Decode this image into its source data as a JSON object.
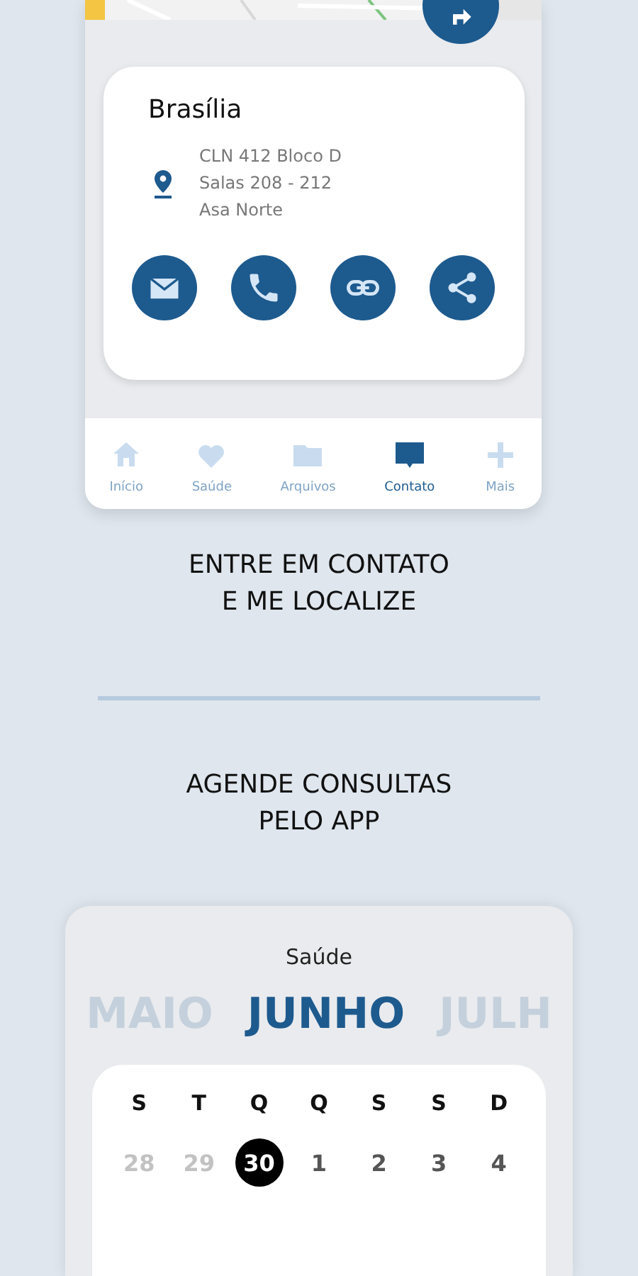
{
  "location": {
    "city": "Brasília",
    "address": [
      "CLN 412 Bloco D",
      "Salas 208 - 212",
      "Asa Norte"
    ]
  },
  "contact_actions": [
    {
      "kind": "email"
    },
    {
      "kind": "phone"
    },
    {
      "kind": "link"
    },
    {
      "kind": "share"
    }
  ],
  "nav": [
    {
      "kind": "home",
      "label": "Início",
      "selected": false
    },
    {
      "kind": "heart",
      "label": "Saúde",
      "selected": false
    },
    {
      "kind": "folder",
      "label": "Arquivos",
      "selected": false
    },
    {
      "kind": "chat",
      "label": "Contato",
      "selected": true
    },
    {
      "kind": "plus",
      "label": "Mais",
      "selected": false
    }
  ],
  "caption_1": [
    "ENTRE EM CONTATO",
    "E ME LOCALIZE"
  ],
  "caption_2": [
    "AGENDE CONSULTAS",
    "PELO APP"
  ],
  "calendar": {
    "title": "Saúde",
    "months": [
      {
        "label": "MAIO",
        "selected": false
      },
      {
        "label": "JUNHO",
        "selected": true
      },
      {
        "label": "JULH",
        "selected": false
      }
    ],
    "weekdays": [
      "S",
      "T",
      "Q",
      "Q",
      "S",
      "S",
      "D"
    ],
    "days": [
      {
        "label": "28",
        "muted": true,
        "selected": false
      },
      {
        "label": "29",
        "muted": true,
        "selected": false
      },
      {
        "label": "30",
        "muted": false,
        "selected": true
      },
      {
        "label": "1",
        "muted": false,
        "selected": false
      },
      {
        "label": "2",
        "muted": false,
        "selected": false
      },
      {
        "label": "3",
        "muted": false,
        "selected": false
      },
      {
        "label": "4",
        "muted": false,
        "selected": false
      }
    ]
  }
}
